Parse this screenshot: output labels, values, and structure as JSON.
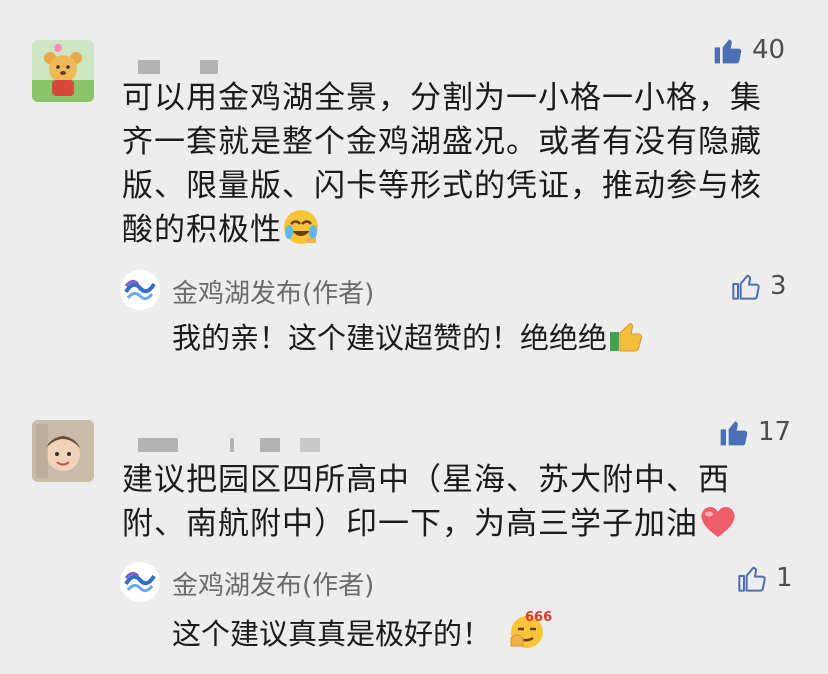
{
  "comments": [
    {
      "likes": "40",
      "text_lines": [
        "可以用金鸡湖全景，分割为一小格一小格，集",
        "齐一套就是整个金鸡湖盛况。或者有没有隐藏",
        "版、限量版、闪卡等形式的凭证，推动参与核",
        "酸的积极性"
      ],
      "reply": {
        "author": "金鸡湖发布(作者)",
        "likes": "3",
        "text": "我的亲！这个建议超赞的！绝绝绝"
      }
    },
    {
      "likes": "17",
      "text_lines": [
        "建议把园区四所高中（星海、苏大附中、西",
        "附、南航附中）印一下，为高三学子加油"
      ],
      "reply": {
        "author": "金鸡湖发布(作者)",
        "likes": "1",
        "text": "这个建议真真是极好的！",
        "emoji_text": "666"
      }
    }
  ],
  "icons": {
    "like_filled": "thumbs-up-filled-icon",
    "like_outline": "thumbs-up-outline-icon"
  },
  "colors": {
    "background": "#ededed",
    "like_blue": "#4a6fb5",
    "reply_author": "#6b6b6b"
  }
}
